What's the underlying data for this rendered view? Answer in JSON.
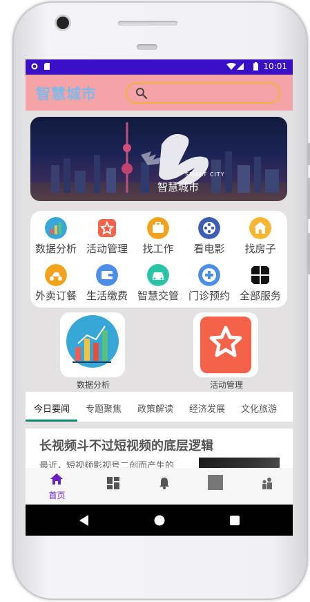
{
  "status_bar": {
    "time": "10:01"
  },
  "header": {
    "title": "智慧城市",
    "search_placeholder": ""
  },
  "banner": {
    "caption_en": "SMART CITY",
    "caption_cn": "智慧城市"
  },
  "services": [
    {
      "label": "数据分析",
      "icon": "chart-icon"
    },
    {
      "label": "活动管理",
      "icon": "star-icon"
    },
    {
      "label": "找工作",
      "icon": "briefcase-icon"
    },
    {
      "label": "看电影",
      "icon": "film-reel-icon"
    },
    {
      "label": "找房子",
      "icon": "house-icon"
    },
    {
      "label": "外卖订餐",
      "icon": "scooter-icon"
    },
    {
      "label": "生活缴费",
      "icon": "wallet-icon"
    },
    {
      "label": "智慧交管",
      "icon": "car-icon"
    },
    {
      "label": "门诊预约",
      "icon": "medical-cross-icon"
    },
    {
      "label": "全部服务",
      "icon": "grid-icon"
    }
  ],
  "featured": [
    {
      "label": "数据分析",
      "icon": "chart-icon"
    },
    {
      "label": "活动管理",
      "icon": "star-icon"
    }
  ],
  "tabs": [
    "今日要闻",
    "专题聚焦",
    "政策解读",
    "经济发展",
    "文化旅游"
  ],
  "news": {
    "title": "长视频斗不过短视频的底层逻辑",
    "summary": "最近，短视频影视号二创而产生的"
  },
  "bottom_nav": {
    "home_label": "首页"
  },
  "colors": {
    "status_bar": "#3a10c6",
    "header": "#f4a3a7",
    "accent": "#6a1ec4",
    "tab_underline": "#0a8a6a"
  }
}
